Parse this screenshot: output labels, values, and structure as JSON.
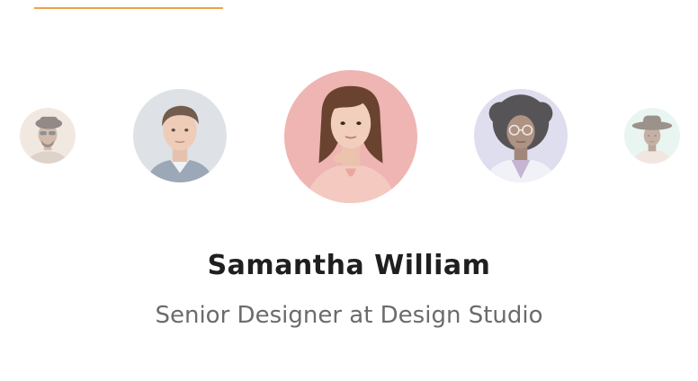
{
  "colors": {
    "accent": "#f0a04b",
    "name_text": "#1f1f1f",
    "role_text": "#6b6b6b"
  },
  "testimonial": {
    "active_name": "Samantha William",
    "active_role": "Senior Designer at Design Studio"
  },
  "avatars": [
    {
      "id": "far-left",
      "icon": "man-with-hat-sunglasses-avatar",
      "active": false
    },
    {
      "id": "left",
      "icon": "young-man-avatar",
      "active": false
    },
    {
      "id": "center",
      "icon": "woman-pink-background-avatar",
      "active": true
    },
    {
      "id": "right",
      "icon": "woman-curly-hair-glasses-avatar",
      "active": false
    },
    {
      "id": "far-right",
      "icon": "woman-with-hat-avatar",
      "active": false
    }
  ]
}
